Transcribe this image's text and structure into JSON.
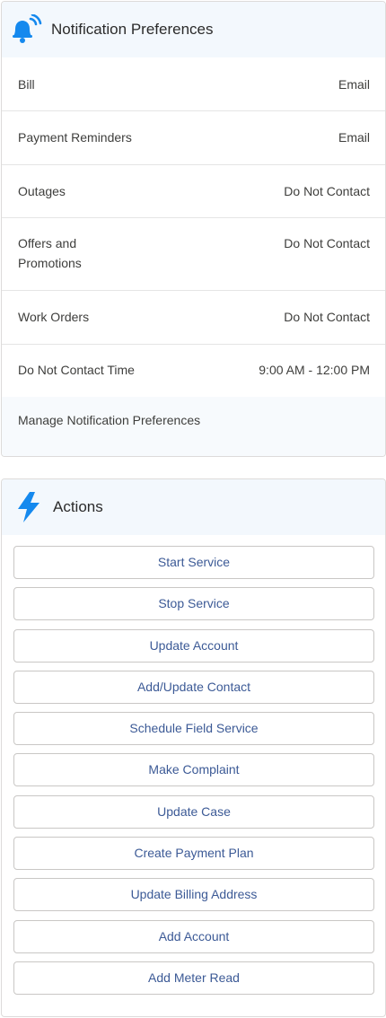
{
  "notifications": {
    "title": "Notification Preferences",
    "icon": "bell-broadcast-icon",
    "accent": "#1589ee",
    "rows": [
      {
        "label": "Bill",
        "value": "Email"
      },
      {
        "label": "Payment Reminders",
        "value": "Email"
      },
      {
        "label": "Outages",
        "value": "Do Not Contact"
      },
      {
        "label": "Offers and Promotions",
        "value": "Do Not Contact"
      },
      {
        "label": "Work Orders",
        "value": "Do Not Contact"
      },
      {
        "label": "Do Not Contact Time",
        "value": "9:00 AM - 12:00 PM"
      }
    ],
    "manage_label": "Manage Notification Preferences"
  },
  "actions": {
    "title": "Actions",
    "icon": "lightning-bolt-icon",
    "buttons": [
      "Start Service",
      "Stop Service",
      "Update Account",
      "Add/Update Contact",
      "Schedule Field Service",
      "Make Complaint",
      "Update Case",
      "Create Payment Plan",
      "Update Billing Address",
      "Add Account",
      "Add Meter Read"
    ]
  }
}
